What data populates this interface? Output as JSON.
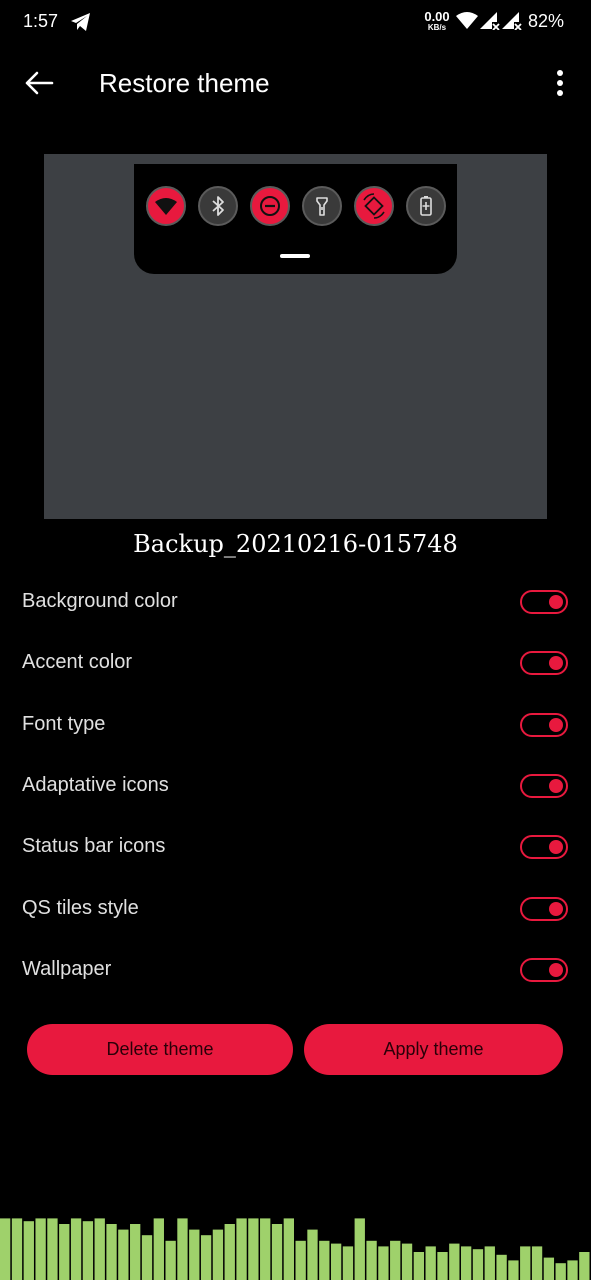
{
  "status_bar": {
    "time": "1:57",
    "net_speed_value": "0.00",
    "net_speed_unit": "KB/s",
    "battery": "82%"
  },
  "app_bar": {
    "title": "Restore theme"
  },
  "preview": {
    "backup_name": "Backup_20210216-015748",
    "tiles": [
      {
        "icon": "wifi-icon",
        "state": "on"
      },
      {
        "icon": "bluetooth-icon",
        "state": "off"
      },
      {
        "icon": "do-not-disturb-icon",
        "state": "on"
      },
      {
        "icon": "flashlight-icon",
        "state": "off"
      },
      {
        "icon": "auto-rotate-icon",
        "state": "on"
      },
      {
        "icon": "battery-saver-icon",
        "state": "off"
      }
    ]
  },
  "options": [
    {
      "label": "Background color",
      "enabled": true
    },
    {
      "label": "Accent color",
      "enabled": true
    },
    {
      "label": "Font type",
      "enabled": true
    },
    {
      "label": "Adaptative icons",
      "enabled": true
    },
    {
      "label": "Status bar icons",
      "enabled": true
    },
    {
      "label": "QS tiles style",
      "enabled": true
    },
    {
      "label": "Wallpaper",
      "enabled": true
    }
  ],
  "buttons": {
    "delete": "Delete theme",
    "apply": "Apply theme"
  },
  "colors": {
    "accent": "#e8193e",
    "background": "#000000",
    "preview_bg": "#3d4044",
    "visualizer": "#9fd16b"
  },
  "visualizer_levels": [
    0.88,
    0.88,
    0.84,
    0.88,
    0.88,
    0.8,
    0.88,
    0.84,
    0.88,
    0.8,
    0.72,
    0.8,
    0.64,
    0.88,
    0.56,
    0.88,
    0.72,
    0.64,
    0.72,
    0.8,
    0.88,
    0.88,
    0.88,
    0.8,
    0.88,
    0.56,
    0.72,
    0.56,
    0.52,
    0.48,
    0.88,
    0.56,
    0.48,
    0.56,
    0.52,
    0.4,
    0.48,
    0.4,
    0.52,
    0.48,
    0.44,
    0.48,
    0.36,
    0.28,
    0.48,
    0.48,
    0.32,
    0.24,
    0.28,
    0.4
  ]
}
